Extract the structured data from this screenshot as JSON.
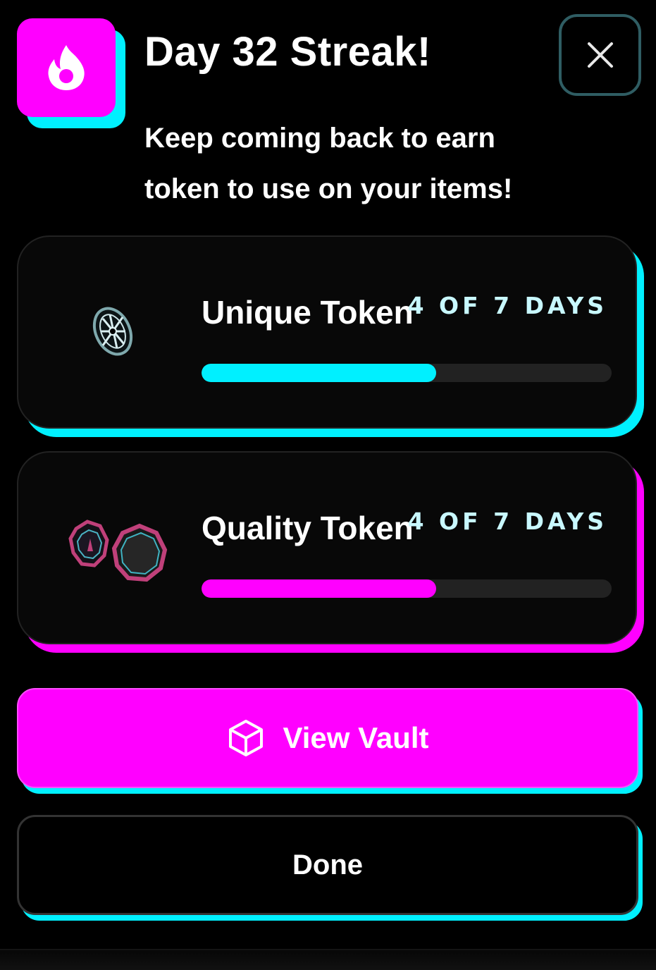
{
  "header": {
    "title": "Day 32 Streak!",
    "subtitle": "Keep coming back to earn token to use on your items!",
    "badge_icon": "flame-icon",
    "close_icon": "close-icon"
  },
  "tokens": [
    {
      "name": "Unique Token",
      "days_label": "4 OF 7 DAYS",
      "progress_days": 4,
      "total_days": 7,
      "accent": "#00f0ff",
      "icon": "unique-token-icon"
    },
    {
      "name": "Quality Token",
      "days_label": "4 OF 7 DAYS",
      "progress_days": 4,
      "total_days": 7,
      "accent": "#ff00ff",
      "icon": "quality-token-icon"
    }
  ],
  "actions": {
    "vault_label": "View Vault",
    "vault_icon": "cube-icon",
    "done_label": "Done"
  },
  "colors": {
    "magenta": "#ff00ff",
    "cyan": "#00f0ff",
    "background": "#000000",
    "track": "#222222",
    "days_text": "#c8f8ff"
  }
}
